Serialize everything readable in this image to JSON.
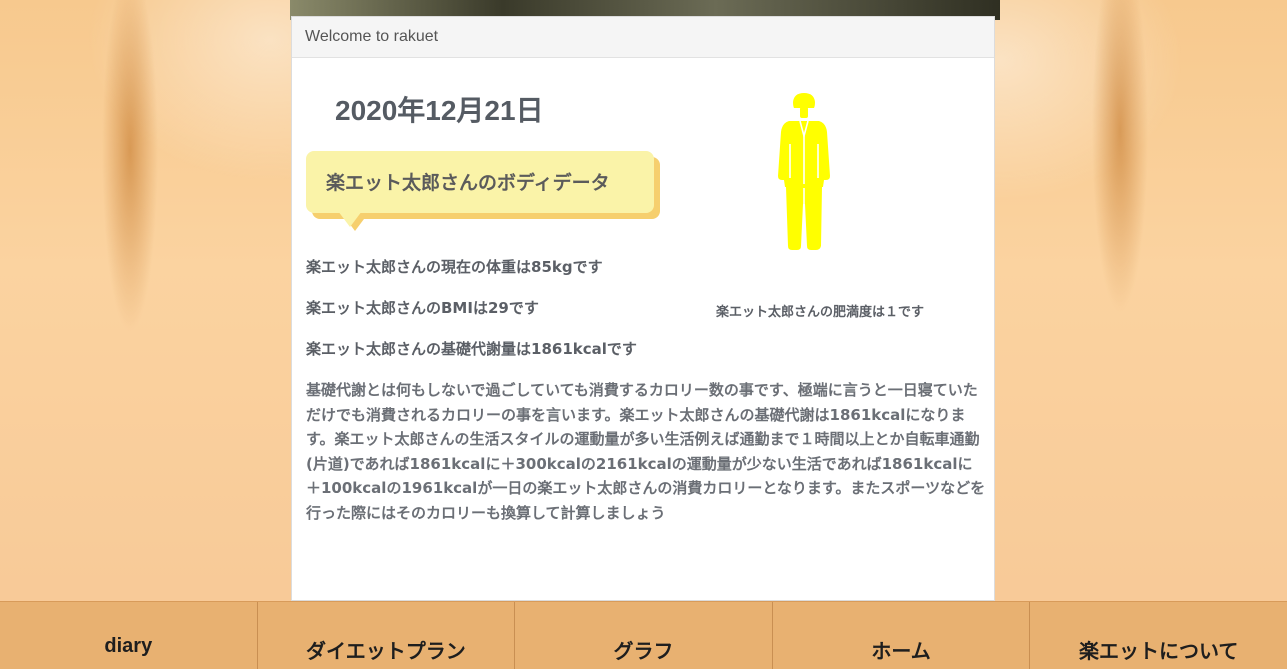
{
  "panel": {
    "header": "Welcome to rakuet",
    "date": "2020年12月21日",
    "section_title": "楽エット太郎さんのボディデータ",
    "weight_text": "楽エット太郎さんの現在の体重は85kgです",
    "bmi_text": "楽エット太郎さんのBMIは29です",
    "bmr_text": "楽エット太郎さんの基礎代謝量は1861kcalです",
    "description": "基礎代謝とは何もしないで過ごしていても消費するカロリー数の事です、極端に言うと一日寝ていただけでも消費されるカロリーの事を言います。楽エット太郎さんの基礎代謝は1861kcalになります。楽エット太郎さんの生活スタイルの運動量が多い生活例えば通勤まで１時間以上とか自転車通勤(片道)であれば1861kcalに＋300kcalの2161kcalの運動量が少ない生活であれば1861kcalに＋100kcalの1961kcalが一日の楽エット太郎さんの消費カロリーとなります。またスポーツなどを行った際にはそのカロリーも換算して計算しましょう",
    "obesity_text": "楽エット太郎さんの肥満度は１です",
    "figure_icon": "person-figure-icon",
    "figure_color": "#ffff00"
  },
  "nav": {
    "items": [
      "diary",
      "ダイエットプラン",
      "グラフ",
      "ホーム",
      "楽エットについて"
    ]
  }
}
